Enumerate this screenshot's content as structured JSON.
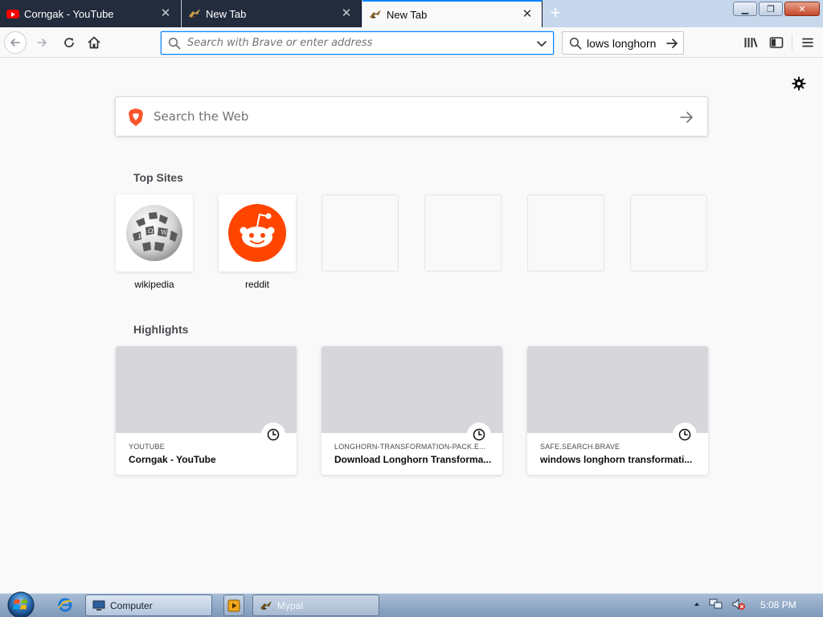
{
  "tabs": [
    {
      "label": "Corngak - YouTube",
      "icon": "youtube-icon",
      "active": false
    },
    {
      "label": "New Tab",
      "icon": "mypal-icon",
      "active": false
    },
    {
      "label": "New Tab",
      "icon": "mypal-icon",
      "active": true
    }
  ],
  "tab_close_glyph": "✕",
  "new_tab_glyph": "+",
  "window_buttons": {
    "minimize": "▁",
    "restore": "❐",
    "close": "✕"
  },
  "navbar": {
    "url_placeholder": "Search with Brave or enter address",
    "search_value": "lows longhorn"
  },
  "content": {
    "websearch_placeholder": "Search the Web",
    "top_sites_title": "Top Sites",
    "highlights_title": "Highlights",
    "top_sites": [
      {
        "label": "wikipedia",
        "icon": "wikipedia-logo-icon"
      },
      {
        "label": "reddit",
        "icon": "reddit-logo-icon"
      },
      {
        "label": "",
        "icon": ""
      },
      {
        "label": "",
        "icon": ""
      },
      {
        "label": "",
        "icon": ""
      },
      {
        "label": "",
        "icon": ""
      }
    ],
    "highlights": [
      {
        "host": "YOUTUBE",
        "title": "Corngak - YouTube"
      },
      {
        "host": "LONGHORN-TRANSFORMATION-PACK.E...",
        "title": "Download Longhorn Transforma..."
      },
      {
        "host": "SAFE.SEARCH.BRAVE",
        "title": "windows longhorn transformati..."
      }
    ]
  },
  "taskbar": {
    "items": [
      {
        "label": "Computer",
        "icon": "computer-icon"
      },
      {
        "label": "",
        "icon": "media-player-icon"
      },
      {
        "label": "Mypal",
        "icon": "mypal-icon"
      }
    ],
    "clock": "5:08 PM"
  },
  "colors": {
    "accent": "#0a84ff",
    "tab_dark": "#232c3d",
    "reddit": "#ff4500",
    "brave": "#fb542b"
  }
}
